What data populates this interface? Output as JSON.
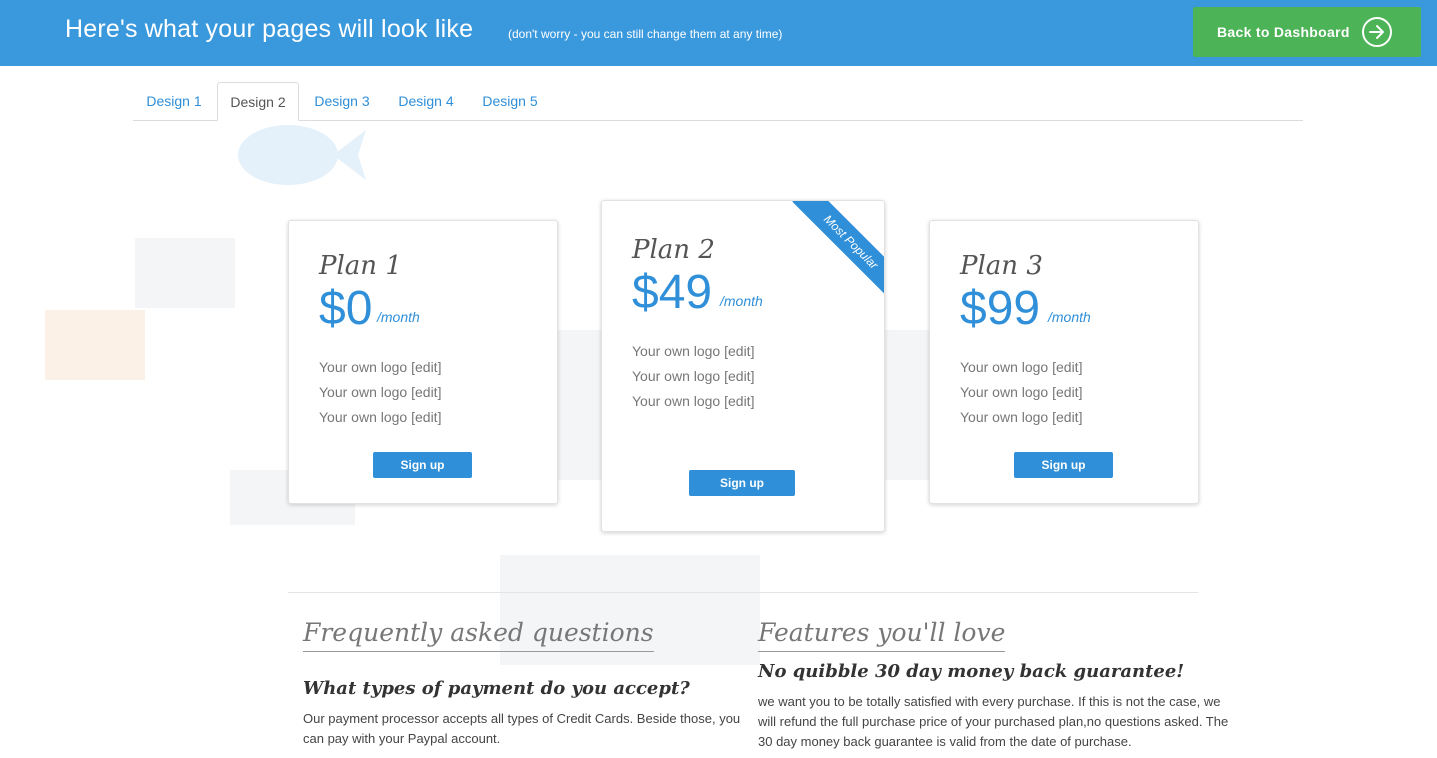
{
  "header": {
    "title": "Here's what your pages will look like",
    "subtitle": "(don't worry - you can still change them at any time)",
    "dashboard_button": "Back to Dashboard"
  },
  "tabs": [
    {
      "label": "Design 1",
      "active": false
    },
    {
      "label": "Design 2",
      "active": true
    },
    {
      "label": "Design 3",
      "active": false
    },
    {
      "label": "Design 4",
      "active": false
    },
    {
      "label": "Design 5",
      "active": false
    }
  ],
  "plans": [
    {
      "name": "Plan 1",
      "price": "$0",
      "period": "/month",
      "features": [
        "Your own logo [edit]",
        "Your own logo [edit]",
        "Your own logo [edit]"
      ],
      "button": "Sign up"
    },
    {
      "name": "Plan 2",
      "price": "$49",
      "period": "/month",
      "features": [
        "Your own logo [edit]",
        "Your own logo [edit]",
        "Your own logo [edit]"
      ],
      "button": "Sign up",
      "ribbon": "Most Popular"
    },
    {
      "name": "Plan 3",
      "price": "$99",
      "period": "/month",
      "features": [
        "Your own logo [edit]",
        "Your own logo [edit]",
        "Your own logo [edit]"
      ],
      "button": "Sign up"
    }
  ],
  "faq": {
    "title": "Frequently asked questions",
    "question": "What types of payment do you accept?",
    "answer": "Our payment processor accepts all types of Credit Cards. Beside those, you can pay with your Paypal account."
  },
  "features_section": {
    "title": "Features you'll love",
    "heading": "No quibble 30 day money back guarantee!",
    "body": "we want you to be totally satisfied with every purchase. If this is not the case, we will refund the full purchase price of your purchased plan,no questions asked. The 30 day money back guarantee is valid from the date of purchase."
  },
  "colors": {
    "header_bg": "#3a98dc",
    "accent": "#2f8fd8",
    "dashboard_button": "#4cb356"
  },
  "icons": {
    "dashboard_arrow": "arrow-right-circle-icon"
  }
}
